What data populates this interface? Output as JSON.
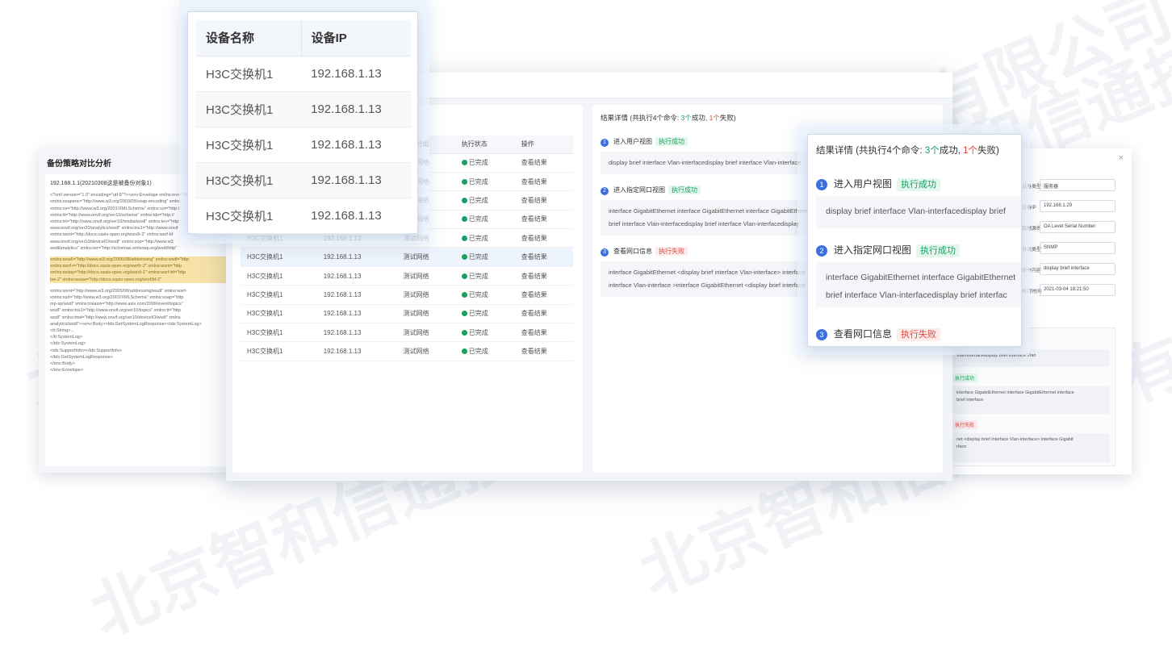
{
  "left_panel": {
    "title": "备份策略对比分析",
    "header": "192.168.1.1(20210308这是被备份对象1)",
    "lines": [
      "<?xml version=\"1.0\" encoding=\"utf-8\"?><env:Envelope xmlns:env=\"http://",
      "xmlns:soapenc=\"http://www.w3.org/2003/05/soap-encoding\" xmlns:",
      "xmlns:xs=\"http://www.w3.org/2001/XMLSchema\" xmlns:xsi=\"http://",
      "xmlns:tt=\"http://www.onvif.org/ver10/schema\" xmlns:tds=\"http://",
      "xmlns:trt=\"http://www.onvif.org/ver10/media/wsdl\" xmlns:tev=\"http",
      "www.onvif.org/ver20/analytics/wsdl\" xmlns:tns1=\"http://www.onvif",
      "xmlns:wsnt=\"http://docs.oasis-open.org/wsn/b-2\" xmlns:wsrf-bf",
      "www.onvif.org/ver10/deviceIO/wsdl\" xmlns:xop=\"http://www.w3",
      "wsdl/analytics\" xmlns:ter=\"http://schemas.xmlsoap.org/wsdl/http\""
    ],
    "highlight_lines": [
      "xmlns:wsa5=\"http://www.w3.org/2005/08/addressing\" xmlns:wsdl=\"http",
      "xmlns:wsrf-r=\"http://docs.oasis-open.org/wsrf/r-2\" xmlns:wsnt=\"http",
      "xmlns:wstop=\"http://docs.oasis-open.org/wsn/t-1\" xmlns:wsrf-bf=\"http",
      "bw-2\" xmlns:wsaw=\"http://docs.oasis-open.org/wsrf/bf-2\""
    ],
    "lines2": [
      "xmlns:wsnt=\"http://www.w3.org/2005/08/addressing/wsdl\" xmlns:wsrf-",
      "xmlns:xsd=\"http://www.w3.org/2001/XMLSchema\" xmlns:soap=\"http",
      "mp-sp/wsdl\" xmlns:tnsaxis=\"http://www.axis.com/2009/event/topics\"",
      "wsdl\" xmlns:tns1=\"http://www.onvif.org/ver10/topics\" xmlns:tt=\"http",
      "wsdl\" xmlns:tmd=\"http://www.onvif.org/ver10/deviceIO/wsdl\" xmlns",
      "analytics/wsdl\"><env:Body><tds:GetSystemLogResponse><tds:SystemLog>",
      "<tt:String>...",
      "</tt:SystemLog>",
      "</tds:SystemLog>",
      "<tds:SupportInfo></tds:SupportInfo>",
      "</tds:GetSystemLogResponse>",
      "</env:Body>",
      "</env:Envelope>"
    ]
  },
  "table": {
    "headers": [
      "设备名称",
      "设备IP",
      "设备分组",
      "执行状态",
      "操作"
    ],
    "rows": [
      [
        "H3C交换机1",
        "192.168.1.13",
        "测试网络",
        "已完成",
        "查看结果"
      ],
      [
        "H3C交换机1",
        "192.168.1.13",
        "测试网络",
        "已完成",
        "查看结果"
      ],
      [
        "H3C交换机1",
        "192.168.1.13",
        "测试网络",
        "已完成",
        "查看结果"
      ],
      [
        "H3C交换机1",
        "192.168.1.13",
        "测试网络",
        "已完成",
        "查看结果"
      ],
      [
        "H3C交换机1",
        "192.168.1.13",
        "测试网络",
        "已完成",
        "查看结果"
      ],
      [
        "H3C交换机1",
        "192.168.1.13",
        "测试网络",
        "已完成",
        "查看结果"
      ],
      [
        "H3C交换机1",
        "192.168.1.13",
        "测试网络",
        "已完成",
        "查看结果"
      ],
      [
        "H3C交换机1",
        "192.168.1.13",
        "测试网络",
        "已完成",
        "查看结果"
      ],
      [
        "H3C交换机1",
        "192.168.1.13",
        "测试网络",
        "已完成",
        "查看结果"
      ],
      [
        "H3C交换机1",
        "192.168.1.13",
        "测试网络",
        "已完成",
        "查看结果"
      ],
      [
        "H3C交换机1",
        "192.168.1.13",
        "测试网络",
        "已完成",
        "查看结果"
      ]
    ]
  },
  "result": {
    "title_prefix": "结果详情 (共执行4个命令: ",
    "success_count": "3个",
    "success_word": "成功, ",
    "fail_count": "1个",
    "fail_word": "失败)",
    "steps": [
      {
        "num": "1",
        "title": "进入用户视图",
        "status": "执行成功",
        "lines": [
          "display brief interface Vlan-interfacedisplay brief interface Vlan-interface"
        ]
      },
      {
        "num": "2",
        "title": "进入指定网口视图",
        "status": "执行成功",
        "lines": [
          "interface GigabitEthernet interface GigabitEthernet interface GigabitEthernet",
          "brief interface Vlan-interfacedisplay brief interface Vlan-interfacedisplay"
        ]
      },
      {
        "num": "3",
        "title": "查看网口信息",
        "status": "执行失败",
        "lines": [
          "interface GigabitEthernet <display brief interface Vlan-interface> interface",
          "interface Vlan-interface >interface GigabitEthernet <display brief interface"
        ]
      }
    ]
  },
  "zoom_table": {
    "headers": [
      "设备名称",
      "设备IP"
    ],
    "rows": [
      [
        "H3C交换机1",
        "192.168.1.13"
      ],
      [
        "H3C交换机1",
        "192.168.1.13"
      ],
      [
        "H3C交换机1",
        "192.168.1.13"
      ],
      [
        "H3C交换机1",
        "192.168.1.13"
      ],
      [
        "H3C交换机1",
        "192.168.1.13"
      ]
    ]
  },
  "zoom_result": {
    "title_prefix": "结果详情 (共执行4个命令: ",
    "success_count": "3个",
    "success_word": "成功, ",
    "fail_count": "1个",
    "fail_word": "失败)",
    "step1_title": "进入用户视图",
    "step1_status": "执行成功",
    "step1_cmd": "display brief interface Vlan-interfacedisplay brief",
    "step2_title": "进入指定网口视图",
    "step2_status": "执行成功",
    "step2_cmd1": "interface GigabitEthernet interface GigabitEthernet",
    "step2_cmd2": "brief interface Vlan-interfacedisplay brief interfac",
    "step3_title": "查看网口信息",
    "step3_status": "执行失败"
  },
  "right_panel": {
    "close": "×",
    "fields": [
      {
        "label": "设备类型",
        "value": "服务器"
      },
      {
        "label": "设备IP",
        "value": "192.168.1.29"
      },
      {
        "label": "数据源名",
        "value": "OA Level  Serial Number"
      },
      {
        "label": "协议类型",
        "value": "SNMP"
      },
      {
        "label": "命令内容",
        "value": "display brief interface"
      },
      {
        "label": "执行时间",
        "value": "2021-03-04 18:21:50"
      }
    ],
    "block1": "Vlan-interfacedisplay brief interface Vlan",
    "tag1": "执行成功",
    "block2_l1": "interface GigabitEthernet interface GigabitEthernet interface",
    "block2_l2": "brief interface",
    "tag2": "执行失败",
    "block3_l1": "net <display brief interface Vlan-interface> interface Gigabit",
    "block3_l2": "rface"
  },
  "watermark": "北京智和信通技术有限公司"
}
